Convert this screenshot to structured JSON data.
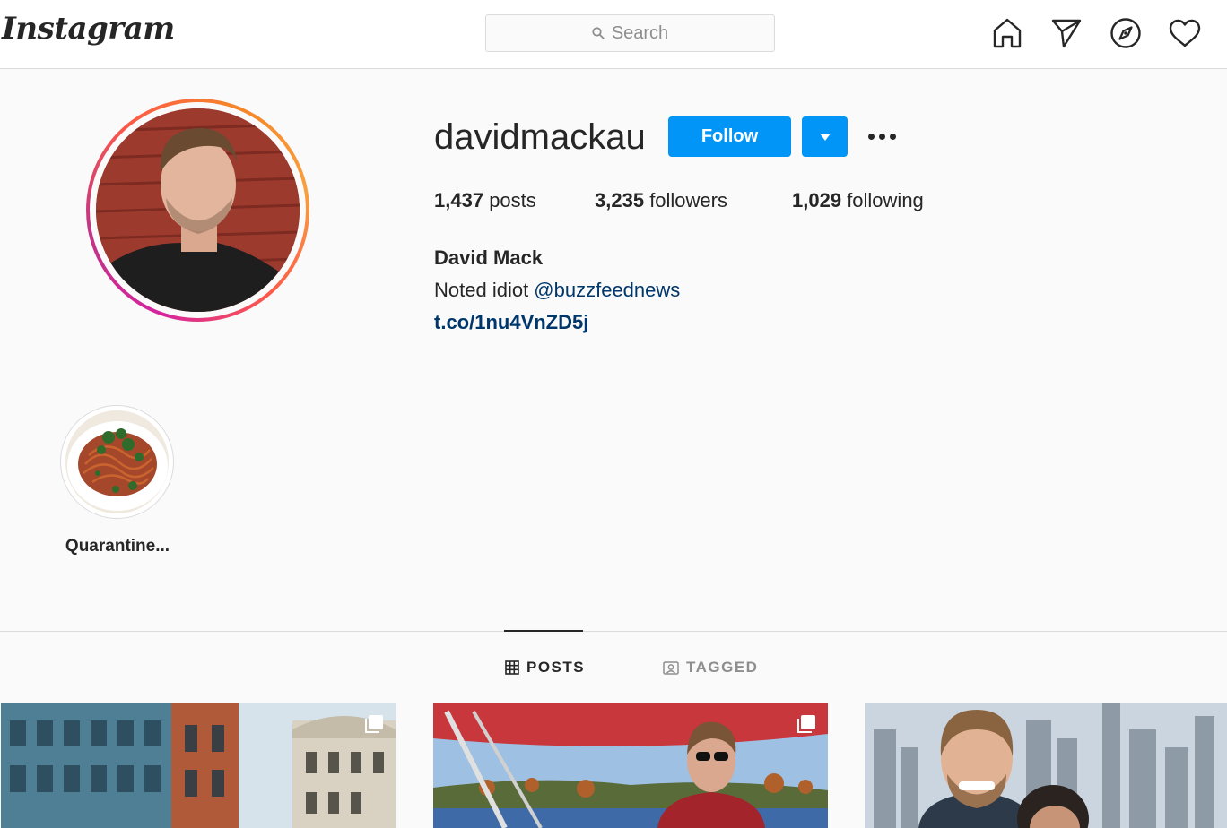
{
  "header": {
    "logo_text": "Instagram",
    "search_placeholder": "Search"
  },
  "profile": {
    "username": "davidmackau",
    "follow_label": "Follow",
    "stats": {
      "posts_count": "1,437",
      "posts_label": "posts",
      "followers_count": "3,235",
      "followers_label": "followers",
      "following_count": "1,029",
      "following_label": "following"
    },
    "full_name": "David Mack",
    "bio_text": "Noted idiot ",
    "bio_mention": "@buzzfeednews",
    "link": "t.co/1nu4VnZD5j"
  },
  "highlights": [
    {
      "label": "Quarantine..."
    }
  ],
  "tabs": {
    "posts": "POSTS",
    "tagged": "TAGGED"
  },
  "colors": {
    "accent": "#0095f6",
    "link": "#00376b",
    "border": "#dbdbdb",
    "muted": "#8e8e8e",
    "background": "#fafafa"
  },
  "icons": [
    "search-icon",
    "home-icon",
    "direct-icon",
    "explore-icon",
    "heart-icon",
    "chevron-down-icon",
    "more-icon",
    "grid-icon",
    "tagged-icon",
    "multiple-icon"
  ]
}
